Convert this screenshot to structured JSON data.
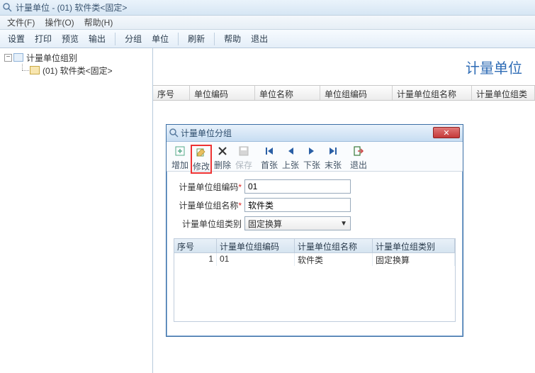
{
  "titlebar": {
    "text": "计量单位 - (01) 软件类<固定>"
  },
  "menubar": {
    "file": "文件(F)",
    "op": "操作(O)",
    "help": "帮助(H)"
  },
  "toolbar": {
    "set": "设置",
    "print": "打印",
    "preview": "预览",
    "output": "输出",
    "group": "分组",
    "unit": "单位",
    "refresh": "刷新",
    "helpb": "帮助",
    "exit": "退出"
  },
  "tree": {
    "root": "计量单位组别",
    "child1": "(01) 软件类<固定>"
  },
  "pageTitle": "计量单位",
  "grid": {
    "c1": "序号",
    "c2": "单位编码",
    "c3": "单位名称",
    "c4": "单位组编码",
    "c5": "计量单位组名称",
    "c6": "计量单位组类"
  },
  "dialog": {
    "title": "计量单位分组",
    "btns": {
      "add": "增加",
      "edit": "修改",
      "del": "删除",
      "save": "保存",
      "first": "首张",
      "prev": "上张",
      "next": "下张",
      "last": "末张",
      "exit": "退出"
    },
    "form": {
      "codeLabel": "计量单位组编码",
      "codeVal": "01",
      "nameLabel": "计量单位组名称",
      "nameVal": "软件类",
      "typeLabel": "计量单位组类别",
      "typeVal": "固定换算"
    },
    "dgridH": {
      "c1": "序号",
      "c2": "计量单位组编码",
      "c3": "计量单位组名称",
      "c4": "计量单位组类别"
    },
    "dgridR": {
      "idx": "1",
      "code": "01",
      "name": "软件类",
      "type": "固定换算"
    }
  }
}
